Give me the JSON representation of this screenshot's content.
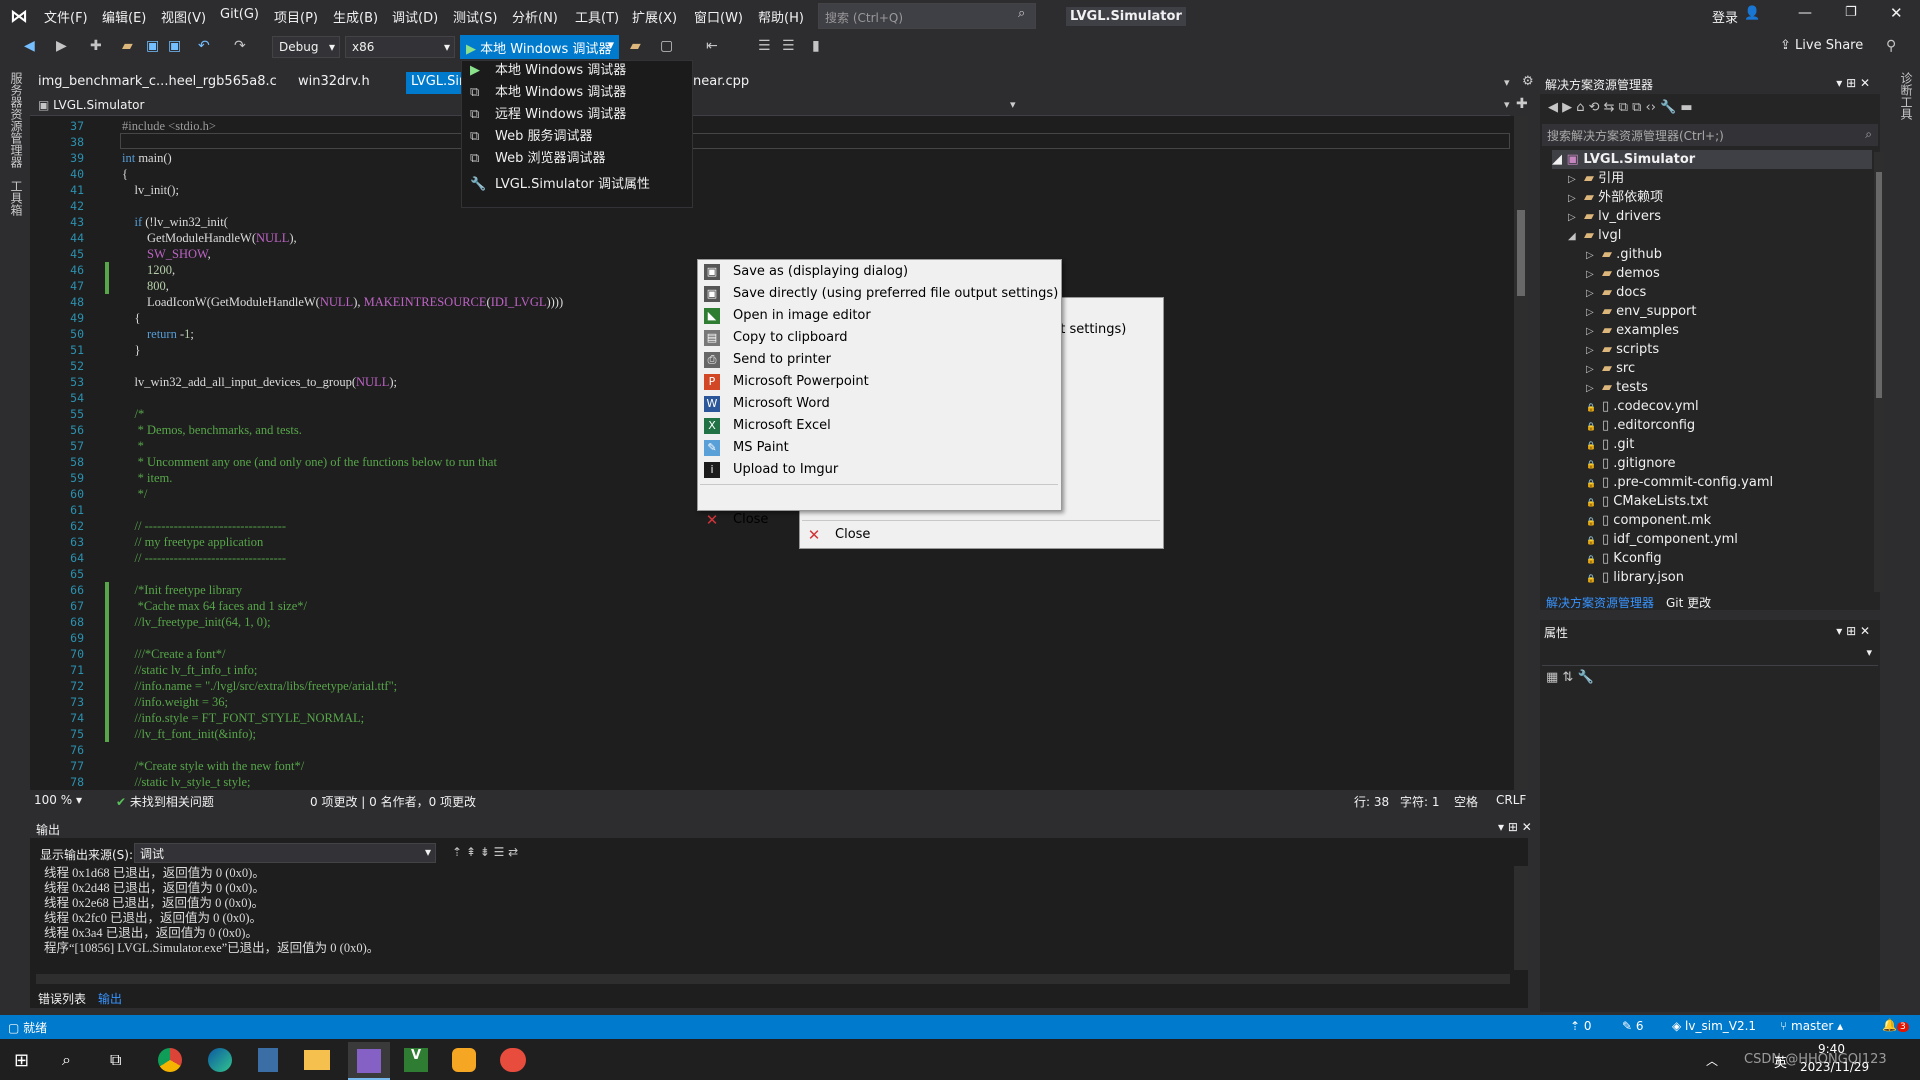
{
  "menubar": {
    "items": [
      "文件(F)",
      "编辑(E)",
      "视图(V)",
      "Git(G)",
      "项目(P)",
      "生成(B)",
      "调试(D)",
      "测试(S)",
      "分析(N)",
      "工具(T)",
      "扩展(X)",
      "窗口(W)",
      "帮助(H)"
    ],
    "search_placeholder": "搜索 (Ctrl+Q)",
    "solution_title": "LVGL.Simulator",
    "login": "登录",
    "live_share": "Live Share"
  },
  "toolbar": {
    "config": "Debug",
    "platform": "x86",
    "run_label": "本地 Windows 调试器"
  },
  "tabs": [
    "img_benchmark_c...heel_rgb565a8.c",
    "win32drv.h",
    "LVGL.Sim",
    "near.cpp"
  ],
  "navbar": {
    "project": "LVGL.Simulator"
  },
  "debugger_menu": {
    "items": [
      "本地 Windows 调试器",
      "本地 Windows 调试器",
      "远程 Windows 调试器",
      "Web 服务调试器",
      "Web 浏览器调试器",
      "LVGL.Simulator 调试属性"
    ]
  },
  "code": {
    "line_numbers": [
      "37",
      "38",
      "39",
      "40",
      "41",
      "42",
      "43",
      "44",
      "45",
      "46",
      "47",
      "48",
      "49",
      "50",
      "51",
      "52",
      "53",
      "54",
      "55",
      "56",
      "57",
      "58",
      "59",
      "60",
      "61",
      "62",
      "63",
      "64",
      "65",
      "66",
      "67",
      "68",
      "69",
      "70",
      "71",
      "72",
      "73",
      "74",
      "75",
      "76",
      "77",
      "78"
    ]
  },
  "context_menu": {
    "items": [
      "Save as (displaying dialog)",
      "Save directly (using preferred file output settings)",
      "Open in image editor",
      "Copy to clipboard",
      "Send to printer",
      "Microsoft Powerpoint",
      "Microsoft Word",
      "Microsoft Excel",
      "MS Paint",
      "Upload to Imgur"
    ],
    "close": "Close"
  },
  "context_menu_back": {
    "partial": "ut settings)",
    "partial2": "Upload to Imgur",
    "close": "Close"
  },
  "editor_status": {
    "zoom": "100 %",
    "issues": "未找到相关问题",
    "changes": "0 项更改 | 0 名作者，0 项更改",
    "line": "行: 38",
    "char": "字符: 1",
    "space": "空格",
    "eol": "CRLF"
  },
  "output": {
    "title": "输出",
    "source_label": "显示输出来源(S):",
    "source": "调试",
    "lines": [
      "线程 0x1d68 已退出，返回值为 0 (0x0)。",
      "线程 0x2d48 已退出，返回值为 0 (0x0)。",
      "线程 0x2e68 已退出，返回值为 0 (0x0)。",
      "线程 0x2fc0 已退出，返回值为 0 (0x0)。",
      "线程 0x3a4 已退出，返回值为 0 (0x0)。",
      "程序“[10856] LVGL.Simulator.exe”已退出，返回值为 0 (0x0)。"
    ],
    "tab_errors": "错误列表",
    "tab_output": "输出"
  },
  "solution_explorer": {
    "title": "解决方案资源管理器",
    "search": "搜索解决方案资源管理器(Ctrl+;)",
    "root": "LVGL.Simulator",
    "items": [
      {
        "label": "引用",
        "level": 1
      },
      {
        "label": "外部依赖项",
        "level": 1
      },
      {
        "label": "lv_drivers",
        "level": 1
      },
      {
        "label": "lvgl",
        "level": 1
      },
      {
        "label": ".github",
        "level": 2
      },
      {
        "label": "demos",
        "level": 2
      },
      {
        "label": "docs",
        "level": 2
      },
      {
        "label": "env_support",
        "level": 2
      },
      {
        "label": "examples",
        "level": 2
      },
      {
        "label": "scripts",
        "level": 2
      },
      {
        "label": "src",
        "level": 2
      },
      {
        "label": "tests",
        "level": 2
      },
      {
        "label": ".codecov.yml",
        "level": 2
      },
      {
        "label": ".editorconfig",
        "level": 2
      },
      {
        "label": ".git",
        "level": 2
      },
      {
        "label": ".gitignore",
        "level": 2
      },
      {
        "label": ".pre-commit-config.yaml",
        "level": 2
      },
      {
        "label": "CMakeLists.txt",
        "level": 2
      },
      {
        "label": "component.mk",
        "level": 2
      },
      {
        "label": "idf_component.yml",
        "level": 2
      },
      {
        "label": "Kconfig",
        "level": 2
      },
      {
        "label": "library.json",
        "level": 2
      }
    ],
    "tab_se": "解决方案资源管理器",
    "tab_git": "Git 更改"
  },
  "properties": {
    "title": "属性"
  },
  "statusbar": {
    "ready": "就绪",
    "errors": "0",
    "pencil": "6",
    "branch_repo": "lv_sim_V2.1",
    "branch": "master",
    "notif": "3"
  },
  "left_sidebar": {
    "a": "服务器资源管理器",
    "b": "工具箱"
  },
  "right_sidebar": {
    "a": "诊断工具"
  },
  "taskbar": {
    "time": "9:40",
    "date": "2023/11/29",
    "ime": "英",
    "watermark": "CSDN @HHONGQI123"
  },
  "colors": {
    "accent": "#007acc",
    "bg": "#1e1e1e",
    "chrome": "#2d2d30"
  }
}
